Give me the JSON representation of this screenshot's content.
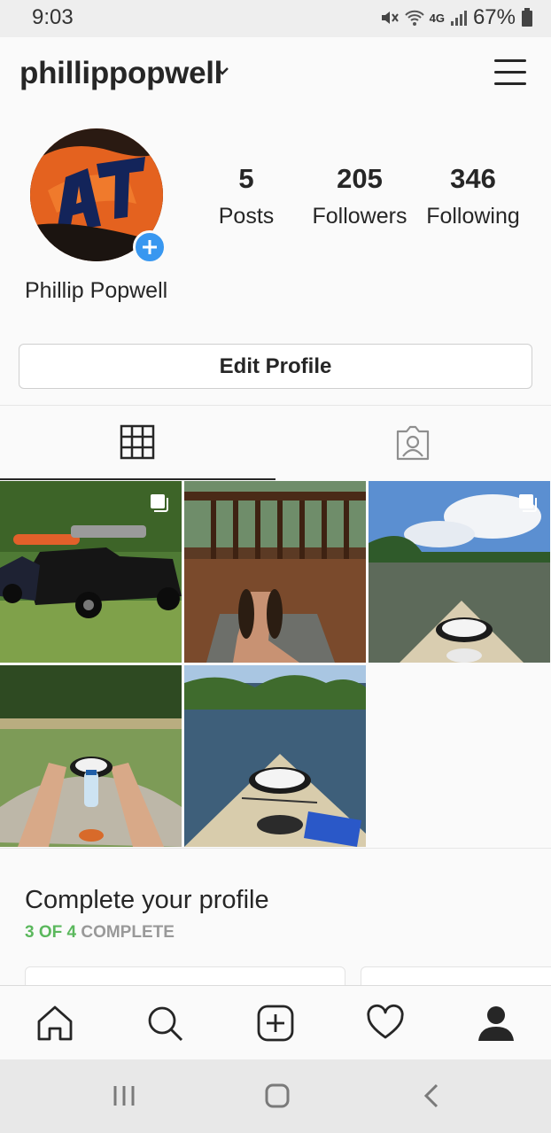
{
  "status_bar": {
    "time": "9:03",
    "network": "4G",
    "battery": "67%"
  },
  "header": {
    "username": "phillippopwell"
  },
  "profile": {
    "full_name": "Phillip Popwell",
    "stats": [
      {
        "value": "5",
        "label": "Posts"
      },
      {
        "value": "205",
        "label": "Followers"
      },
      {
        "value": "346",
        "label": "Following"
      }
    ],
    "edit_button_label": "Edit Profile"
  },
  "tabs": [
    {
      "name": "grid",
      "icon": "grid-icon",
      "active": true
    },
    {
      "name": "tagged",
      "icon": "tagged-portrait-icon",
      "active": false
    }
  ],
  "posts": [
    {
      "subject": "black pickup truck with kayak on roof",
      "multiple": true
    },
    {
      "subject": "feet in sandals on wooden deck",
      "multiple": false
    },
    {
      "subject": "kayak bow on river under cloudy sky",
      "multiple": true
    },
    {
      "subject": "legs in kayak with water bottle",
      "multiple": false
    },
    {
      "subject": "kayak bow on lake with blue towel",
      "multiple": false
    }
  ],
  "complete_profile": {
    "title": "Complete your profile",
    "progress_done": "3 OF 4",
    "progress_suffix": "COMPLETE"
  },
  "bottom_nav": [
    "home-icon",
    "search-icon",
    "add-post-icon",
    "activity-heart-icon",
    "profile-icon"
  ],
  "colors": {
    "accent_blue": "#3897f0",
    "progress_green": "#5bb85d",
    "text": "#262626"
  }
}
